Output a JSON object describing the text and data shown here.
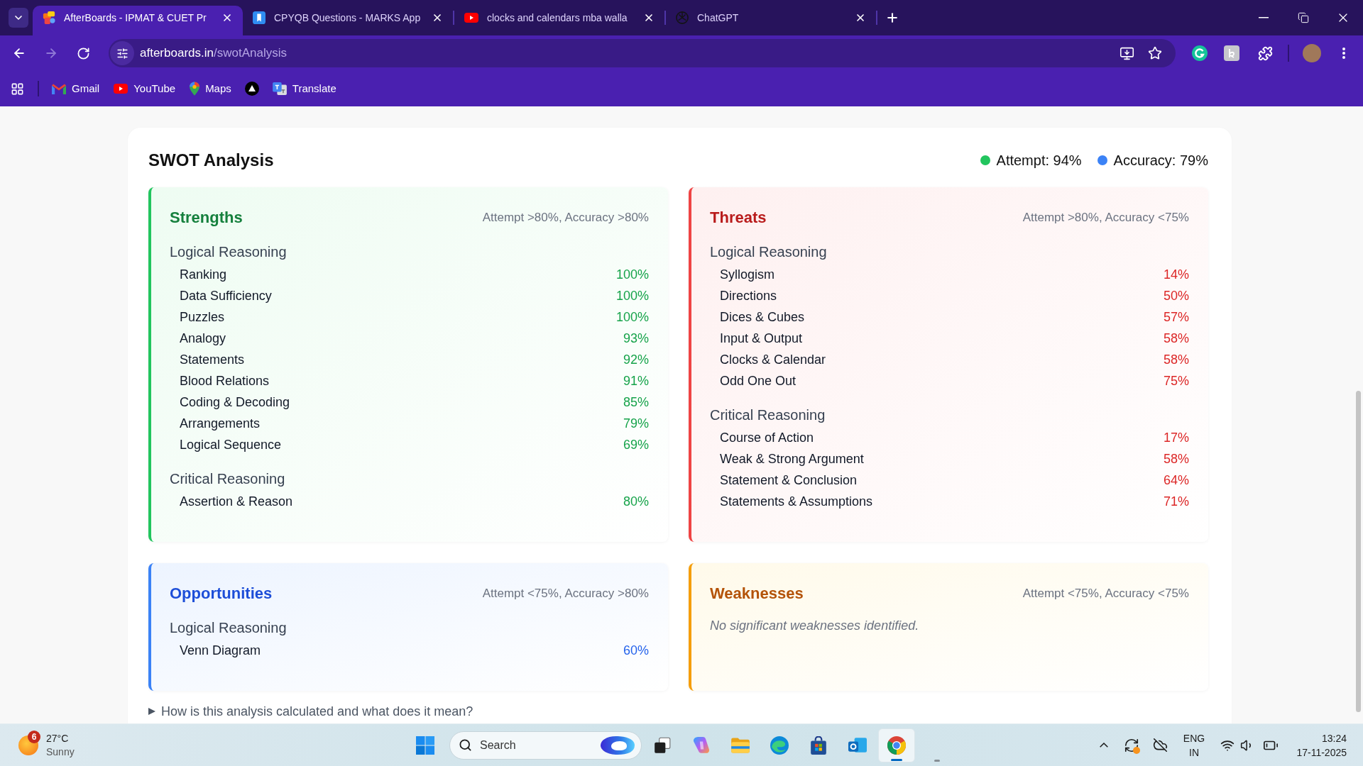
{
  "browser": {
    "tabs": [
      {
        "title": "AfterBoards - IPMAT & CUET Pr",
        "selected": true
      },
      {
        "title": "CPYQB Questions - MARKS App",
        "selected": false
      },
      {
        "title": "clocks and calendars mba walla",
        "selected": false
      },
      {
        "title": "ChatGPT",
        "selected": false
      }
    ],
    "toolbar": {
      "back": {
        "disabled": false
      },
      "forward": {
        "disabled": true
      }
    },
    "address": {
      "host": "afterboards.in",
      "path": "/swotAnalysis"
    },
    "bookmarks": [
      {
        "kind": "link",
        "label": "Gmail"
      },
      {
        "kind": "link",
        "label": "YouTube"
      },
      {
        "kind": "link",
        "label": "Maps"
      },
      {
        "kind": "icon"
      },
      {
        "kind": "link",
        "label": "Translate"
      }
    ]
  },
  "page": {
    "title": "SWOT Analysis",
    "legend": [
      {
        "label": "Attempt: 94%",
        "color": "#22c55e"
      },
      {
        "label": "Accuracy: 79%",
        "color": "#3b82f6"
      }
    ],
    "quadrants": [
      {
        "kind": "strengths",
        "title": "Strengths",
        "criteria": "Attempt >80%, Accuracy >80%",
        "groups": [
          {
            "name": "Logical Reasoning",
            "topics": [
              {
                "name": "Ranking",
                "score": "100%"
              },
              {
                "name": "Data Sufficiency",
                "score": "100%"
              },
              {
                "name": "Puzzles",
                "score": "100%"
              },
              {
                "name": "Analogy",
                "score": "93%"
              },
              {
                "name": "Statements",
                "score": "92%"
              },
              {
                "name": "Blood Relations",
                "score": "91%"
              },
              {
                "name": "Coding & Decoding",
                "score": "85%"
              },
              {
                "name": "Arrangements",
                "score": "79%"
              },
              {
                "name": "Logical Sequence",
                "score": "69%"
              }
            ]
          },
          {
            "name": "Critical Reasoning",
            "topics": [
              {
                "name": "Assertion & Reason",
                "score": "80%"
              }
            ]
          }
        ]
      },
      {
        "kind": "threats",
        "title": "Threats",
        "criteria": "Attempt >80%, Accuracy <75%",
        "groups": [
          {
            "name": "Logical Reasoning",
            "topics": [
              {
                "name": "Syllogism",
                "score": "14%"
              },
              {
                "name": "Directions",
                "score": "50%"
              },
              {
                "name": "Dices & Cubes",
                "score": "57%"
              },
              {
                "name": "Input & Output",
                "score": "58%"
              },
              {
                "name": "Clocks & Calendar",
                "score": "58%"
              },
              {
                "name": "Odd One Out",
                "score": "75%"
              }
            ]
          },
          {
            "name": "Critical Reasoning",
            "topics": [
              {
                "name": "Course of Action",
                "score": "17%"
              },
              {
                "name": "Weak & Strong Argument",
                "score": "58%"
              },
              {
                "name": "Statement & Conclusion",
                "score": "64%"
              },
              {
                "name": "Statements & Assumptions",
                "score": "71%"
              }
            ]
          }
        ]
      },
      {
        "kind": "opportunities",
        "title": "Opportunities",
        "criteria": "Attempt <75%, Accuracy >80%",
        "groups": [
          {
            "name": "Logical Reasoning",
            "topics": [
              {
                "name": "Venn Diagram",
                "score": "60%"
              }
            ]
          }
        ]
      },
      {
        "kind": "weaknesses",
        "title": "Weaknesses",
        "criteria": "Attempt <75%, Accuracy <75%",
        "empty_message": "No significant weaknesses identified."
      }
    ],
    "details": {
      "summary": "How is this analysis calculated and what does it mean?",
      "expanded": false
    }
  },
  "taskbar": {
    "weather": {
      "badge": "6",
      "temperature": "27°C",
      "condition": "Sunny"
    },
    "search": {
      "placeholder": "Search"
    },
    "apps": [
      {
        "selected": false
      },
      {
        "selected": false
      },
      {
        "selected": false
      },
      {
        "selected": false
      },
      {
        "selected": false
      },
      {
        "selected": false
      },
      {
        "selected": true
      }
    ],
    "language": {
      "primary": "ENG",
      "secondary": "IN"
    },
    "clock": {
      "time": "13:24",
      "date": "17-11-2025"
    }
  }
}
